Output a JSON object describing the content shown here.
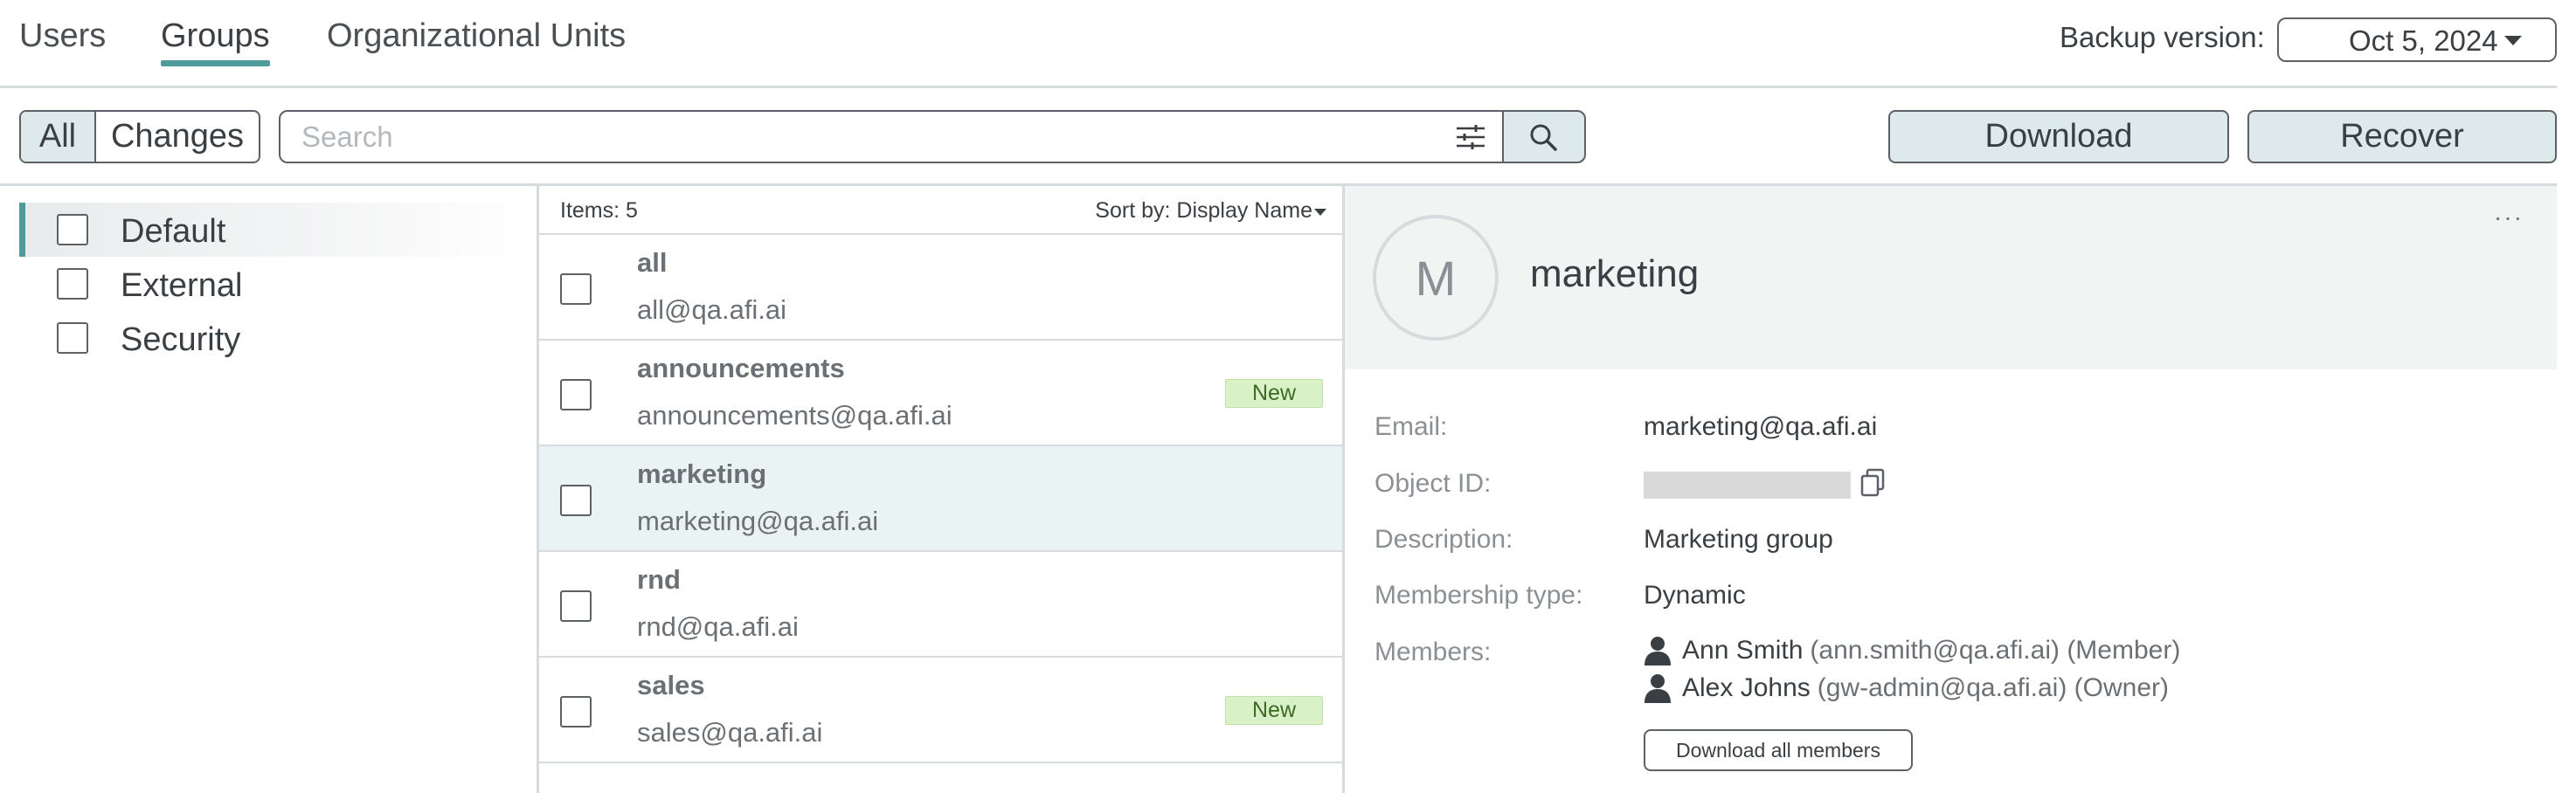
{
  "tabs": [
    {
      "label": "Users",
      "active": false
    },
    {
      "label": "Groups",
      "active": true
    },
    {
      "label": "Organizational Units",
      "active": false
    }
  ],
  "backup": {
    "label": "Backup version:",
    "selected": "Oct 5, 2024"
  },
  "toolbar": {
    "filter_all": "All",
    "filter_changes": "Changes",
    "search_placeholder": "Search",
    "download_label": "Download",
    "recover_label": "Recover"
  },
  "group_types": [
    {
      "label": "Default",
      "selected": true
    },
    {
      "label": "External",
      "selected": false
    },
    {
      "label": "Security",
      "selected": false
    }
  ],
  "list": {
    "items_count": "Items: 5",
    "sort_label": "Sort by: Display Name",
    "rows": [
      {
        "name": "all",
        "email": "all@qa.afi.ai",
        "badge": ""
      },
      {
        "name": "announcements",
        "email": "announcements@qa.afi.ai",
        "badge": "New"
      },
      {
        "name": "marketing",
        "email": "marketing@qa.afi.ai",
        "badge": ""
      },
      {
        "name": "rnd",
        "email": "rnd@qa.afi.ai",
        "badge": ""
      },
      {
        "name": "sales",
        "email": "sales@qa.afi.ai",
        "badge": "New"
      }
    ],
    "selected_row": "marketing"
  },
  "details": {
    "avatar_letter": "M",
    "title": "marketing",
    "more_label": "···",
    "email_label": "Email:",
    "email_value": "marketing@qa.afi.ai",
    "object_id_label": "Object ID:",
    "description_label": "Description:",
    "description_value": "Marketing group",
    "membership_label": "Membership type:",
    "membership_value": "Dynamic",
    "members_label": "Members:",
    "members": [
      {
        "name": "Ann Smith",
        "detail": "(ann.smith@qa.afi.ai) (Member)"
      },
      {
        "name": "Alex Johns",
        "detail": "(gw-admin@qa.afi.ai) (Owner)"
      }
    ],
    "download_members_label": "Download all members"
  },
  "colors": {
    "accent": "#4f9a9a",
    "button_bg": "#dde9eb",
    "badge_bg": "#d9f1c6",
    "selected_row": "#eaf3f3"
  }
}
